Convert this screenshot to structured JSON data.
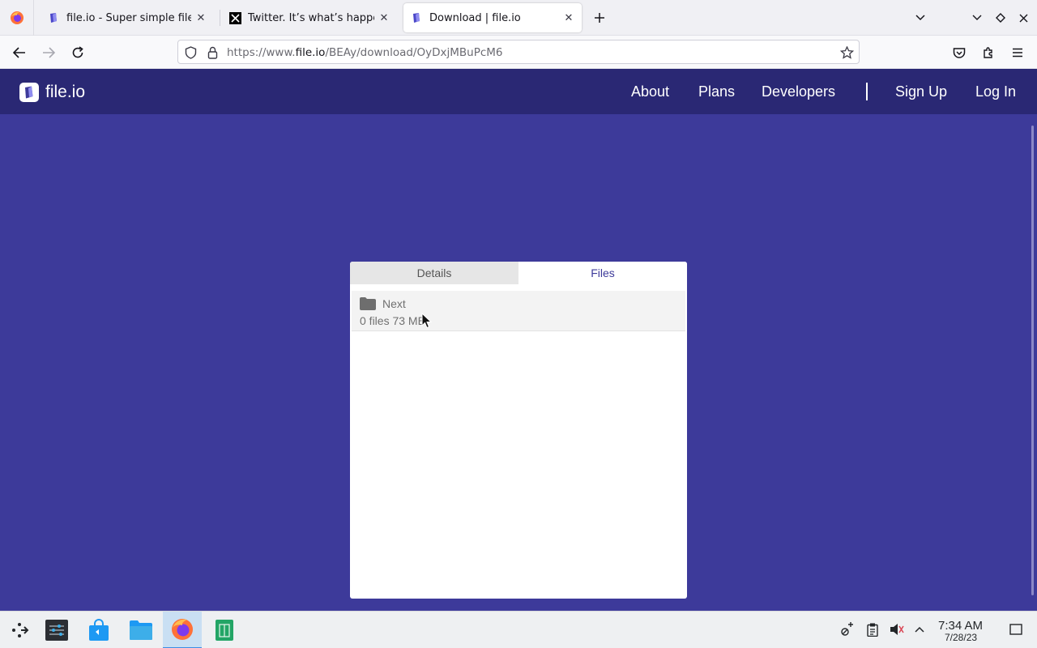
{
  "browser": {
    "tabs": [
      {
        "title": "file.io - Super simple file sh",
        "active": false
      },
      {
        "title": "Twitter. It’s what’s happeni",
        "active": false
      },
      {
        "title": "Download | file.io",
        "active": true
      }
    ],
    "url": {
      "prefix": "https://www.",
      "host": "file.io",
      "path": "/BEAy/download/OyDxjMBuPcM6"
    }
  },
  "site": {
    "brand": "file.io",
    "nav": {
      "about": "About",
      "plans": "Plans",
      "developers": "Developers",
      "sign_up": "Sign Up",
      "log_in": "Log In"
    },
    "colors": {
      "page_bg": "#3d3a9a",
      "header_bg": "#2a2874"
    }
  },
  "card": {
    "tabs": {
      "details": "Details",
      "files": "Files"
    },
    "active_tab": "Files",
    "files": [
      {
        "name": "Next",
        "meta": "0 files 73 MB",
        "icon": "folder-icon"
      }
    ]
  },
  "taskbar": {
    "time": "7:34 AM",
    "date": "7/28/23"
  }
}
